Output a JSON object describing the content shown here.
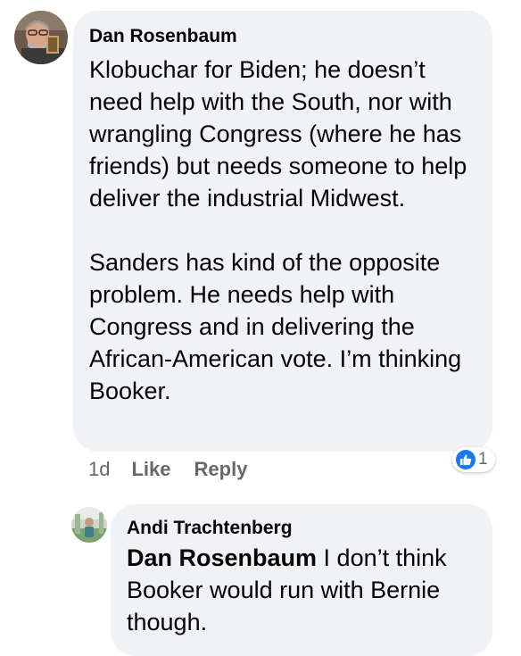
{
  "comment": {
    "author": "Dan Rosenbaum",
    "text": "Klobuchar for Biden; he doesn’t need help with the South, nor with wrangling Congress (where he has friends) but needs someone to help deliver the industrial Midwest.\n\nSanders has kind of the opposite problem. He needs help with Congress and in delivering the African-American vote. I’m thinking Booker.",
    "timestamp": "1d",
    "like_label": "Like",
    "reply_label": "Reply",
    "reaction_count": "1",
    "reaction_icon": "like-thumbs-up-icon",
    "reaction_color": "#1877f2"
  },
  "reply": {
    "author": "Andi Trachtenberg",
    "mention": "Dan Rosenbaum",
    "text": " I don’t think Booker would run with Bernie though."
  },
  "colors": {
    "bubble": "#f0f2f5",
    "text": "#050505",
    "secondary": "#65676b"
  }
}
